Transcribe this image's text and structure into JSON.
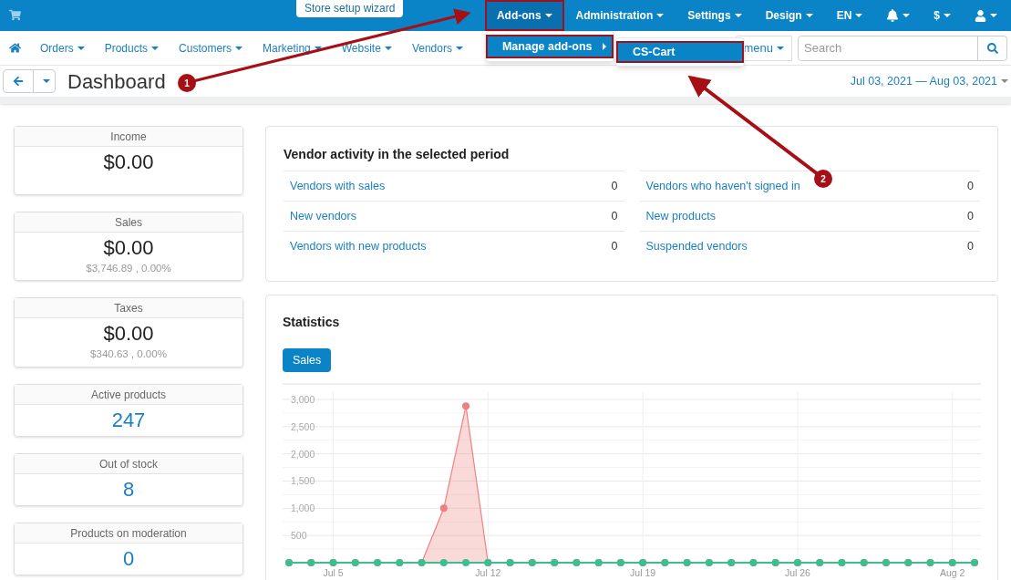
{
  "top_bar": {
    "wizard": "Store setup wizard",
    "items": [
      {
        "kind": "menu",
        "label": "Add-ons",
        "selected": true,
        "highlighted": true
      },
      {
        "kind": "menu",
        "label": "Administration",
        "selected": false,
        "highlighted": false
      },
      {
        "kind": "menu",
        "label": "Settings",
        "selected": false,
        "highlighted": false
      },
      {
        "kind": "menu",
        "label": "Design",
        "selected": false,
        "highlighted": false
      },
      {
        "kind": "menu",
        "label": "EN",
        "selected": false,
        "highlighted": false
      },
      {
        "kind": "notifications",
        "selected": false,
        "highlighted": false
      },
      {
        "kind": "menu",
        "label": "$",
        "selected": false,
        "highlighted": false
      },
      {
        "kind": "account",
        "selected": false,
        "highlighted": false
      }
    ]
  },
  "dropdown": {
    "item": {
      "label": "Manage add-ons",
      "highlighted": true
    },
    "submenu": {
      "label": "CS-Cart",
      "highlighted": true
    }
  },
  "nav": {
    "items": [
      "Orders",
      "Products",
      "Customers",
      "Marketing",
      "Website",
      "Vendors"
    ],
    "menu_button": "menu",
    "search": {
      "placeholder": "Search"
    }
  },
  "page": {
    "title": "Dashboard",
    "date_range": "Jul 03, 2021 — Aug 03, 2021"
  },
  "stats": [
    {
      "kind": "money",
      "label": "Income",
      "value": "$0.00"
    },
    {
      "kind": "money",
      "label": "Sales",
      "value": "$0.00",
      "sub": "$3,746.89 , 0.00%"
    },
    {
      "kind": "money",
      "label": "Taxes",
      "value": "$0.00",
      "sub": "$340.63 , 0.00%"
    },
    {
      "kind": "count",
      "label": "Active products",
      "value": "247"
    },
    {
      "kind": "count",
      "label": "Out of stock",
      "value": "8"
    },
    {
      "kind": "count",
      "label": "Products on moderation",
      "value": "0"
    }
  ],
  "vendor_activity": {
    "title": "Vendor activity in the selected period",
    "columns": [
      [
        {
          "label": "Vendors with sales",
          "value": "0"
        },
        {
          "label": "New vendors",
          "value": "0"
        },
        {
          "label": "Vendors with new products",
          "value": "0"
        }
      ],
      [
        {
          "label": "Vendors who haven't signed in",
          "value": "0"
        },
        {
          "label": "New products",
          "value": "0"
        },
        {
          "label": "Suspended vendors",
          "value": "0"
        }
      ]
    ]
  },
  "statistics": {
    "title": "Statistics",
    "tabs": [
      {
        "label": "Sales",
        "selected": true
      }
    ],
    "chart_data": {
      "type": "area",
      "categories": [
        null,
        null,
        "Jul 5",
        null,
        null,
        null,
        null,
        null,
        null,
        "Jul 12",
        null,
        null,
        null,
        null,
        null,
        null,
        "Jul 19",
        null,
        null,
        null,
        null,
        null,
        null,
        "Jul 26",
        null,
        null,
        null,
        null,
        null,
        null,
        "Aug 2",
        null
      ],
      "yticks": [
        {
          "value": 500,
          "label": "500"
        },
        {
          "value": 1000,
          "label": "1,000"
        },
        {
          "value": 1500,
          "label": "1,500"
        },
        {
          "value": 2000,
          "label": "2,000"
        },
        {
          "value": 2500,
          "label": "2,500"
        },
        {
          "value": 3000,
          "label": "3,000"
        }
      ],
      "ylim": [
        0,
        3100
      ],
      "grid": true,
      "series": [
        {
          "color": "#f08080",
          "marker": true,
          "values": [
            0,
            0,
            0,
            0,
            0,
            0,
            0,
            1000,
            2880,
            0,
            0,
            0,
            0,
            0,
            0,
            0,
            0,
            0,
            0,
            0,
            0,
            0,
            0,
            0,
            0,
            0,
            0,
            0,
            0,
            0,
            0,
            0
          ]
        },
        {
          "color": "#3cbf8f",
          "type": "line",
          "marker": true,
          "values": [
            0,
            0,
            0,
            0,
            0,
            0,
            0,
            0,
            0,
            0,
            0,
            0,
            0,
            0,
            0,
            0,
            0,
            0,
            0,
            0,
            0,
            0,
            0,
            0,
            0,
            0,
            0,
            0,
            0,
            0,
            0,
            0
          ]
        }
      ]
    }
  },
  "annotations": [
    {
      "number": "1"
    },
    {
      "number": "2"
    }
  ]
}
